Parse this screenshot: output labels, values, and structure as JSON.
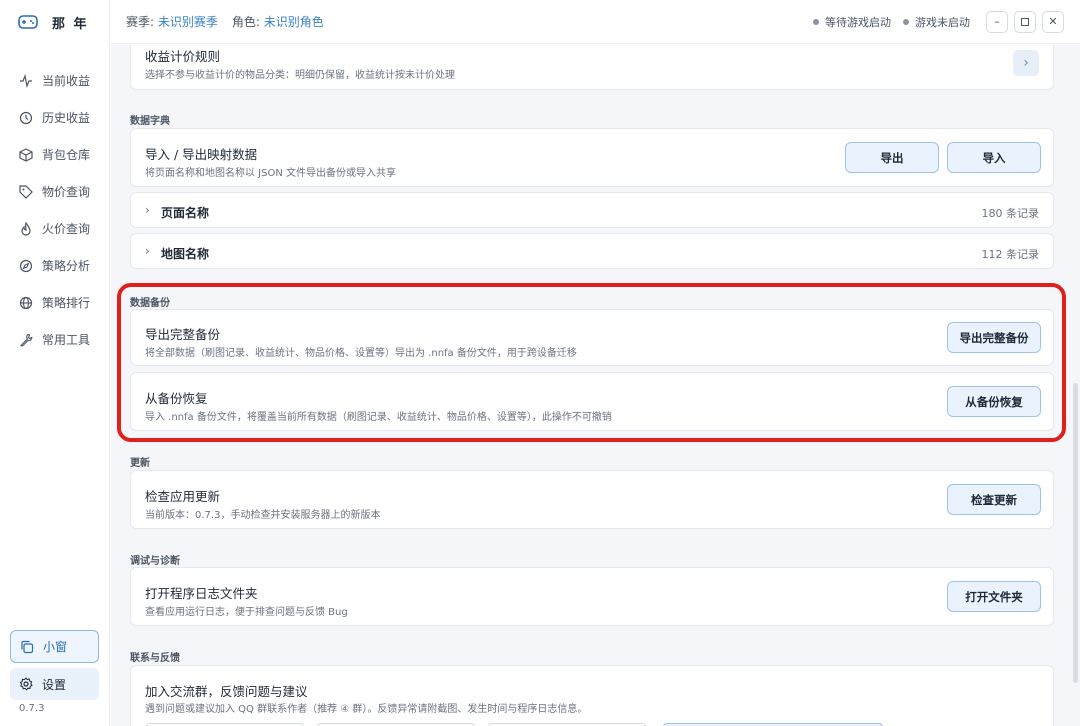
{
  "app": {
    "name": "那 年",
    "version": "0.7.3"
  },
  "sidebar": {
    "items": [
      {
        "label": "当前收益",
        "icon": "pulse-icon"
      },
      {
        "label": "历史收益",
        "icon": "history-icon"
      },
      {
        "label": "背包仓库",
        "icon": "box-icon"
      },
      {
        "label": "物价查询",
        "icon": "tag-icon"
      },
      {
        "label": "火价查询",
        "icon": "flame-icon"
      },
      {
        "label": "策略分析",
        "icon": "compass-icon"
      },
      {
        "label": "策略排行",
        "icon": "globe-icon"
      },
      {
        "label": "常用工具",
        "icon": "wrench-icon"
      }
    ],
    "mini_window": "小窗",
    "settings": "设置"
  },
  "topbar": {
    "season_label": "赛季:",
    "season_value": "未识别赛季",
    "role_label": "角色:",
    "role_value": "未识别角色",
    "status_game": "等待游戏启动",
    "status_running": "游戏未启动"
  },
  "main": {
    "pricing_rules": {
      "title": "收益计价规则",
      "desc": "选择不参与收益计价的物品分类：明细仍保留，收益统计按未计价处理"
    },
    "dictionary": {
      "section": "数据字典",
      "import_export": {
        "title": "导入 / 导出映射数据",
        "desc": "将页面名称和地图名称以 JSON 文件导出备份或导入共享",
        "export_label": "导出",
        "import_label": "导入"
      },
      "rows": [
        {
          "title": "页面名称",
          "count": "180 条记录"
        },
        {
          "title": "地图名称",
          "count": "112 条记录"
        }
      ]
    },
    "backup": {
      "section": "数据备份",
      "export": {
        "title": "导出完整备份",
        "desc": "将全部数据（刷图记录、收益统计、物品价格、设置等）导出为 .nnfa 备份文件，用于跨设备迁移",
        "button": "导出完整备份"
      },
      "restore": {
        "title": "从备份恢复",
        "desc": "导入 .nnfa 备份文件，将覆盖当前所有数据（刷图记录、收益统计、物品价格、设置等），此操作不可撤销",
        "button": "从备份恢复"
      }
    },
    "update": {
      "section": "更新",
      "title": "检查应用更新",
      "desc": "当前版本：0.7.3，手动检查并安装服务器上的新版本",
      "button": "检查更新"
    },
    "debug": {
      "section": "调试与诊断",
      "title": "打开程序日志文件夹",
      "desc": "查看应用运行日志，便于排查问题与反馈 Bug",
      "button": "打开文件夹"
    },
    "contact": {
      "section": "联系与反馈",
      "title": "加入交流群，反馈问题与建议",
      "desc": "遇到问题或建议加入 QQ 群联系作者（推荐 ④ 群）。反馈异常请附截图、发生时间与程序日志信息。"
    }
  },
  "colors": {
    "accent": "#3b82c4",
    "highlight": "#e0201a",
    "button_bg": "#eaf3fd"
  }
}
